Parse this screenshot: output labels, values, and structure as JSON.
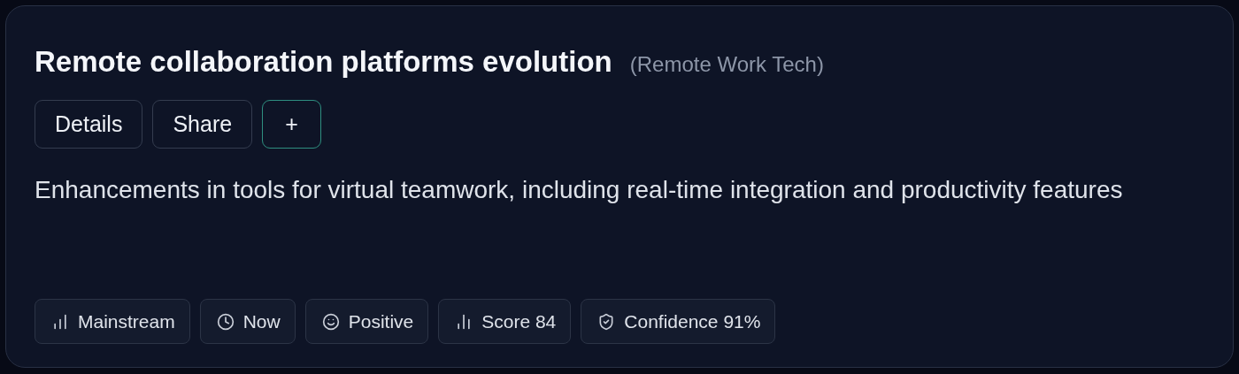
{
  "card": {
    "title": "Remote collaboration platforms evolution",
    "category": "(Remote Work Tech)",
    "buttons": [
      {
        "label": "Details",
        "kind": "plain"
      },
      {
        "label": "Share",
        "kind": "plain"
      },
      {
        "label": "+",
        "kind": "accent"
      }
    ],
    "description": "Enhancements in tools for virtual teamwork, including real-time integration and productivity features",
    "tags": [
      {
        "label": "Mainstream",
        "kind": "stage"
      },
      {
        "label": "Now",
        "kind": "time"
      },
      {
        "label": "Positive",
        "kind": "sentiment"
      },
      {
        "label": "Score 84",
        "kind": "score"
      },
      {
        "label": "Confidence 91%",
        "kind": "confidence"
      }
    ]
  }
}
